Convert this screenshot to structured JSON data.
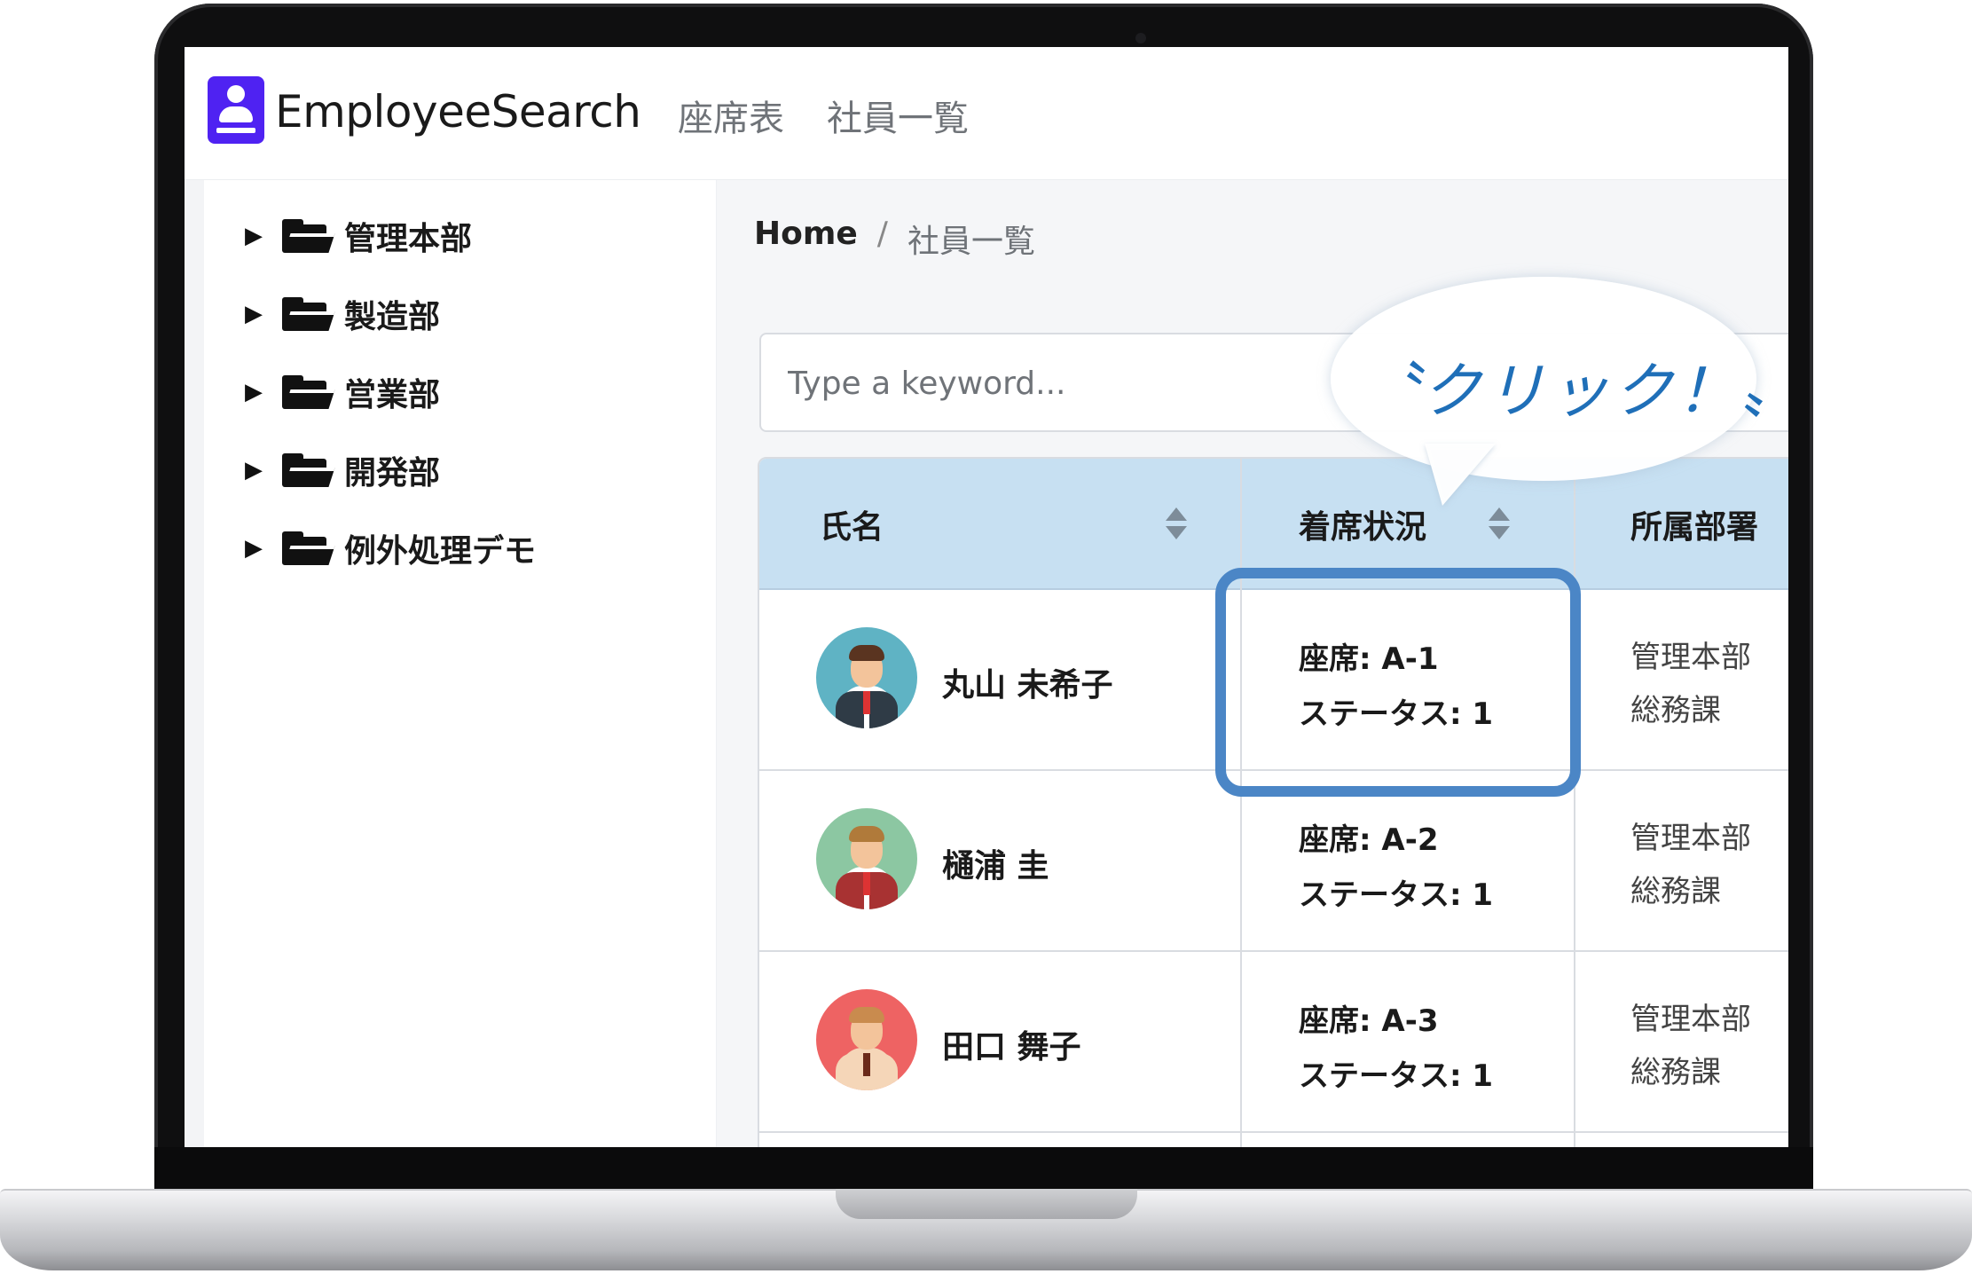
{
  "app": {
    "brand_name": "EmployeeSearch",
    "brand_color": "#4f22f2",
    "nav": [
      {
        "label": "座席表"
      },
      {
        "label": "社員一覧"
      }
    ]
  },
  "sidebar": {
    "items": [
      {
        "label": "管理本部",
        "icon": "folder-open-icon"
      },
      {
        "label": "製造部",
        "icon": "folder-open-icon"
      },
      {
        "label": "営業部",
        "icon": "folder-open-icon"
      },
      {
        "label": "開発部",
        "icon": "folder-open-icon"
      },
      {
        "label": "例外処理デモ",
        "icon": "folder-open-icon"
      }
    ]
  },
  "breadcrumb": {
    "home": "Home",
    "separator": "/",
    "current": "社員一覧"
  },
  "search": {
    "placeholder": "Type a keyword...",
    "value": ""
  },
  "table": {
    "header_color": "#c7e0f2",
    "columns": [
      {
        "label": "氏名",
        "sortable": true
      },
      {
        "label": "着席状況",
        "sortable": true
      },
      {
        "label": "所属部署",
        "sortable": false
      }
    ],
    "rows": [
      {
        "name": "丸山 未希子",
        "avatar": "male-avatar-teal",
        "seat": "座席: A-1",
        "status": "ステータス: 1",
        "dept": "管理本部",
        "section": "総務課"
      },
      {
        "name": "樋浦 圭",
        "avatar": "male-avatar-green",
        "seat": "座席: A-2",
        "status": "ステータス: 1",
        "dept": "管理本部",
        "section": "総務課"
      },
      {
        "name": "田口 舞子",
        "avatar": "male-avatar-red",
        "seat": "座席: A-3",
        "status": "ステータス: 1",
        "dept": "管理本部",
        "section": "総務課"
      }
    ]
  },
  "annotation": {
    "callout": "〝クリック！〟",
    "highlight_color": "#4b86c6"
  }
}
